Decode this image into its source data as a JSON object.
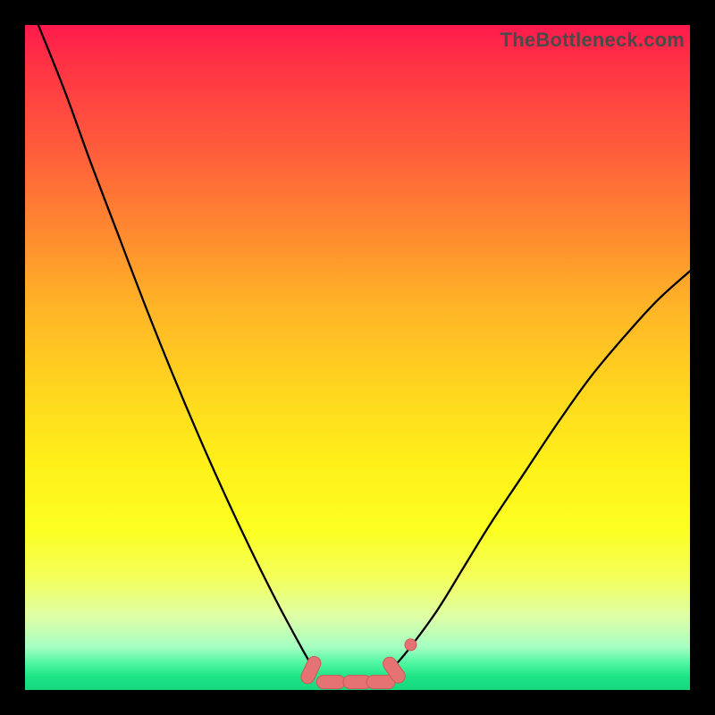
{
  "brand_label": "TheBottleneck.com",
  "colors": {
    "frame": "#000000",
    "curve": "#000000",
    "marker_fill": "#e57373",
    "marker_stroke": "#ca5a5a",
    "gradient_top": "#ff1a4d",
    "gradient_bottom": "#16d87d"
  },
  "chart_data": {
    "type": "line",
    "title": "",
    "xlabel": "",
    "ylabel": "",
    "xlim": [
      0,
      100
    ],
    "ylim": [
      0,
      100
    ],
    "grid": false,
    "legend": false,
    "series": [
      {
        "name": "left-curve",
        "x": [
          2,
          6,
          10,
          14,
          18,
          22,
          26,
          30,
          34,
          38,
          41.5,
          43.5
        ],
        "y": [
          100,
          90,
          79,
          68.5,
          58,
          48,
          38.5,
          29.5,
          21,
          13,
          6.5,
          3
        ]
      },
      {
        "name": "right-curve",
        "x": [
          55.5,
          58,
          62,
          66,
          70,
          75,
          80,
          85,
          90,
          95,
          100
        ],
        "y": [
          3.5,
          6.5,
          12,
          18.5,
          25,
          32.5,
          40,
          47,
          53,
          58.5,
          63
        ]
      },
      {
        "name": "floor",
        "x": [
          43.5,
          55.5
        ],
        "y": [
          1.2,
          1.2
        ]
      }
    ],
    "markers": [
      {
        "shape": "pill",
        "x": 43.0,
        "y": 3.0,
        "angle": -65
      },
      {
        "shape": "pill",
        "x": 46.0,
        "y": 1.2,
        "angle": 0
      },
      {
        "shape": "pill",
        "x": 50.0,
        "y": 1.2,
        "angle": 0
      },
      {
        "shape": "pill",
        "x": 53.5,
        "y": 1.2,
        "angle": 0
      },
      {
        "shape": "pill",
        "x": 55.5,
        "y": 3.0,
        "angle": 55
      },
      {
        "shape": "dot",
        "x": 58.0,
        "y": 6.8,
        "angle": 0
      }
    ]
  }
}
